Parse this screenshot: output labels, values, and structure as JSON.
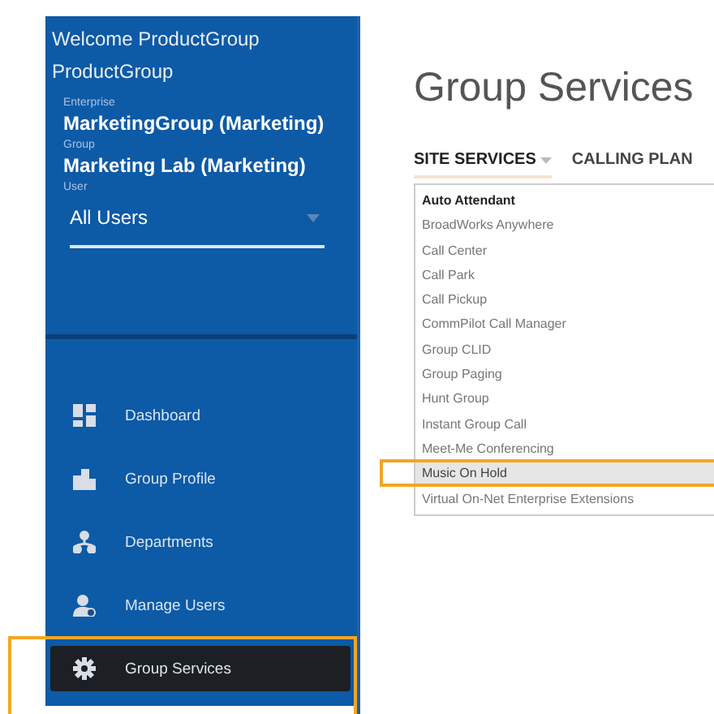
{
  "sidebar": {
    "welcome": "Welcome ProductGroup ProductGroup",
    "fields": [
      {
        "label": "Enterprise",
        "value": "MarketingGroup (Marketing)"
      },
      {
        "label": "Group",
        "value": "Marketing Lab (Marketing)"
      }
    ],
    "user_select": {
      "label": "User",
      "value": "All Users"
    },
    "nav": [
      {
        "label": "Dashboard",
        "selected": false,
        "annotated": false
      },
      {
        "label": "Group Profile",
        "selected": false,
        "annotated": false
      },
      {
        "label": "Departments",
        "selected": false,
        "annotated": false
      },
      {
        "label": "Manage Users",
        "selected": false,
        "annotated": false
      },
      {
        "label": "Group Services",
        "selected": true,
        "annotated": true
      }
    ]
  },
  "main": {
    "title": "Group Services",
    "tabs": [
      {
        "label": "SITE SERVICES",
        "selected": true,
        "kind": "dropdown"
      },
      {
        "label": "CALLING PLAN",
        "selected": false,
        "kind": "plain"
      }
    ],
    "dropdown": [
      {
        "label": "Auto Attendant",
        "focused": true,
        "selected": false,
        "annotated": false
      },
      {
        "label": "BroadWorks Anywhere",
        "focused": false,
        "selected": false,
        "annotated": false
      },
      {
        "label": "Call Center",
        "focused": false,
        "selected": false,
        "annotated": false
      },
      {
        "label": "Call Park",
        "focused": false,
        "selected": false,
        "annotated": false
      },
      {
        "label": "Call Pickup",
        "focused": false,
        "selected": false,
        "annotated": false
      },
      {
        "label": "CommPilot Call Manager",
        "focused": false,
        "selected": false,
        "annotated": false
      },
      {
        "label": "Group CLID",
        "focused": false,
        "selected": false,
        "annotated": false
      },
      {
        "label": "Group Paging",
        "focused": false,
        "selected": false,
        "annotated": false
      },
      {
        "label": "Hunt Group",
        "focused": false,
        "selected": false,
        "annotated": false
      },
      {
        "label": "Instant Group Call",
        "focused": false,
        "selected": false,
        "annotated": false
      },
      {
        "label": "Meet-Me Conferencing",
        "focused": false,
        "selected": false,
        "annotated": false
      },
      {
        "label": "Music On Hold",
        "focused": false,
        "selected": true,
        "annotated": true
      },
      {
        "label": "Virtual On-Net Enterprise Extensions",
        "focused": false,
        "selected": false,
        "annotated": false
      }
    ]
  }
}
